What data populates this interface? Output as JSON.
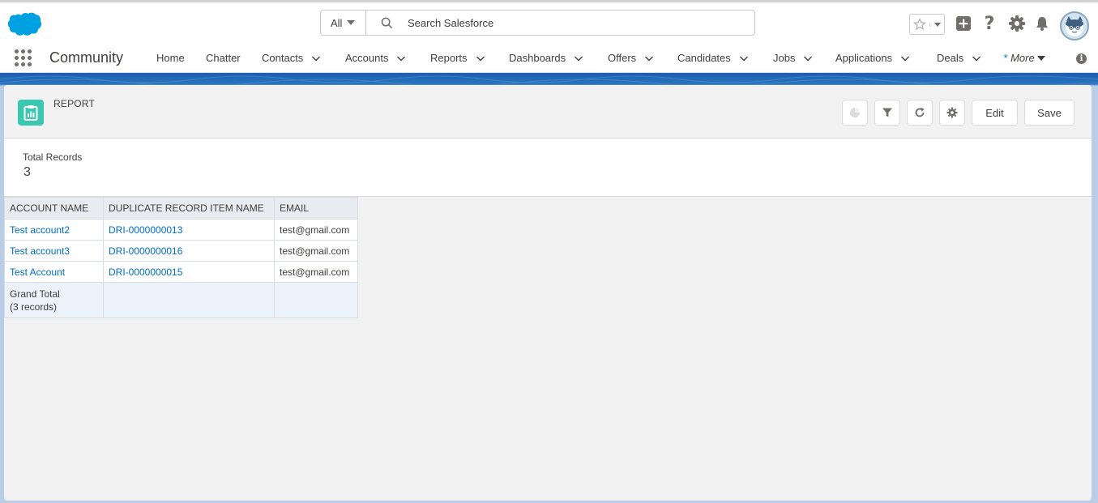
{
  "header": {
    "search": {
      "scope": "All",
      "placeholder": "Search Salesforce"
    },
    "icons": [
      "salesforce-cloud-logo",
      "favorites-star-icon",
      "global-actions-icon",
      "help-icon",
      "setup-gear-icon",
      "notifications-bell-icon",
      "user-avatar"
    ]
  },
  "nav": {
    "app_name": "Community",
    "items": [
      {
        "label": "Home",
        "dropdown": false
      },
      {
        "label": "Chatter",
        "dropdown": false
      },
      {
        "label": "Contacts",
        "dropdown": true
      },
      {
        "label": "Accounts",
        "dropdown": true
      },
      {
        "label": "Reports",
        "dropdown": true
      },
      {
        "label": "Dashboards",
        "dropdown": true
      },
      {
        "label": "Offers",
        "dropdown": true
      },
      {
        "label": "Candidates",
        "dropdown": true
      },
      {
        "label": "Jobs",
        "dropdown": true
      },
      {
        "label": "Applications",
        "dropdown": true
      },
      {
        "label": "Deals",
        "dropdown": true
      }
    ],
    "more_prefix": "*",
    "more_label": "More"
  },
  "report": {
    "type_label": "REPORT",
    "actions": {
      "edit": "Edit",
      "save": "Save"
    },
    "summary": {
      "label": "Total Records",
      "value": "3"
    },
    "columns": [
      "ACCOUNT NAME",
      "DUPLICATE RECORD ITEM NAME",
      "EMAIL"
    ],
    "rows": [
      [
        "Test account2",
        "DRI-0000000013",
        "test@gmail.com"
      ],
      [
        "Test account3",
        "DRI-0000000016",
        "test@gmail.com"
      ],
      [
        "Test Account",
        "DRI-0000000015",
        "test@gmail.com"
      ]
    ],
    "grand_total": {
      "label": "Grand Total",
      "count": "(3 records)"
    }
  },
  "colors": {
    "brand_blue": "#1b5fae",
    "report_icon": "#3bc8b1",
    "link": "#006dcc"
  }
}
